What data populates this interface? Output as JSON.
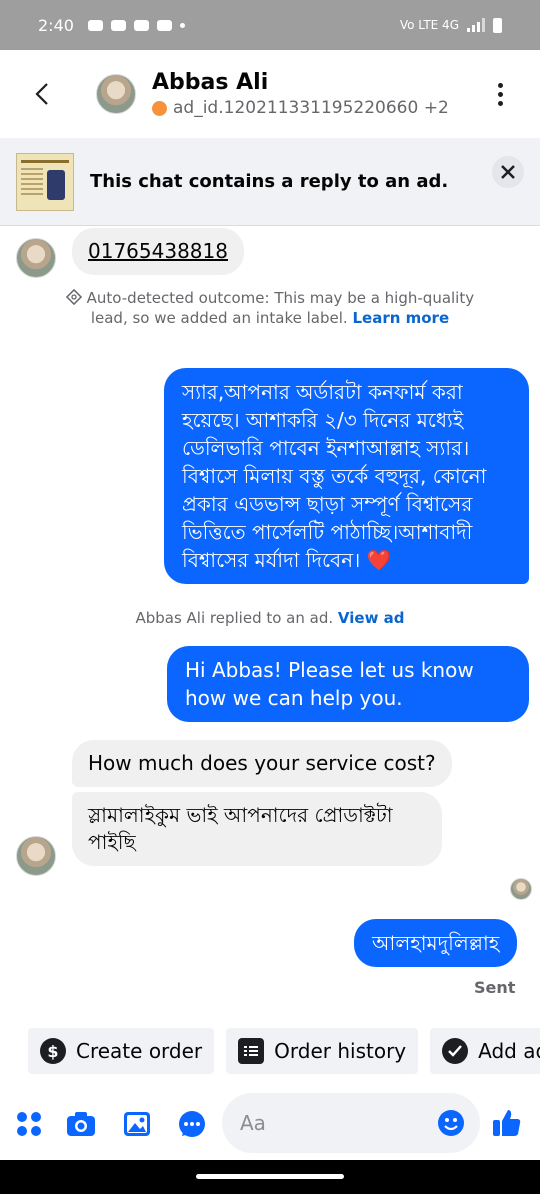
{
  "status_bar": {
    "time": "2:40",
    "network": "Vo LTE 4G"
  },
  "header": {
    "name": "Abbas Ali",
    "subtitle": "ad_id.120211331195220660 +2",
    "status_color": "#f7923a"
  },
  "banner": {
    "text": "This chat contains a reply to an ad."
  },
  "messages": {
    "phone": "01765438818",
    "auto_note": "Auto-detected outcome: This may be a high-quality lead, so we added an intake label.",
    "auto_note_link": "Learn more",
    "order_confirm": "স্যার,আপনার অর্ডারটা কনফার্ম করা হয়েছে। আশাকরি ২/৩ দিনের মধ্যেই ডেলিভারি পাবেন ইনশাআল্লাহ স্যার। বিশ্বাসে মিলায় বস্তু তর্কে বহুদূর, কোনো প্রকার এডভান্স ছাড়া সম্পূর্ণ বিশ্বাসের ভিত্তিতে পার্সেলটি পাঠাচ্ছি।আশাবাদী বিশ্বাসের মর্যাদা দিবেন। ❤️",
    "ad_reply_note": "Abbas Ali replied to an ad.",
    "ad_reply_link": "View ad",
    "greeting": "Hi Abbas! Please let us know how we can help you.",
    "question": "How much does your service cost?",
    "bengali_reply": "স্লামালাইকুম ভাই আপনাদের প্রোডাক্টটা পাইছি",
    "alhamdulillah": "আলহামদুলিল্লাহ",
    "sent_status": "Sent"
  },
  "quick_actions": [
    {
      "label": "Create order",
      "icon": "dollar-icon"
    },
    {
      "label": "Order history",
      "icon": "list-icon"
    },
    {
      "label": "Add ad",
      "icon": "check-circle-icon"
    }
  ],
  "composer": {
    "placeholder": "Aa"
  },
  "colors": {
    "outgoing_bubble": "#0a66ff",
    "incoming_bubble": "#f0f0f0",
    "accent": "#0a66cc"
  }
}
